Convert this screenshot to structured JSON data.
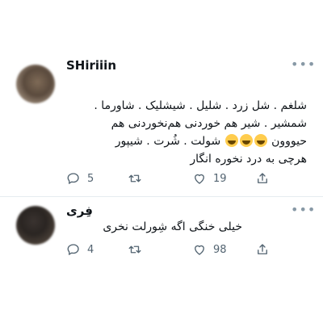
{
  "tweets": [
    {
      "author": "SHiriiin",
      "more": "•••",
      "lines": [
        "شلغم . شل زرد . شلیل . شیشلیک . شاورما .",
        "شمشیر . شیر هم خوردنی هم‌نخوردنی هم",
        "حیووون",
        "شولت . شُرت . شیپور",
        "هرچی به درد نخوره انگار"
      ],
      "reply_count": "5",
      "retweet_count": "",
      "like_count": "19",
      "icons": [
        "reply-icon",
        "retweet-icon",
        "like-icon",
        "share-icon"
      ]
    },
    {
      "author": "فِری",
      "more": "•••",
      "lines": [
        "خیلی خنگی اگه شِورلت نخری"
      ],
      "reply_count": "4",
      "retweet_count": "",
      "like_count": "98",
      "icons": [
        "reply-icon",
        "retweet-icon",
        "like-icon",
        "share-icon"
      ]
    }
  ],
  "colors": {
    "icon": "#536471",
    "divider": "#e6ecf0",
    "text": "#0f1419"
  }
}
